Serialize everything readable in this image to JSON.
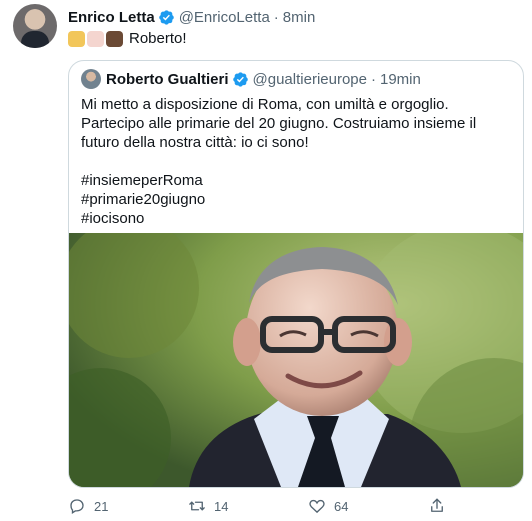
{
  "tweet": {
    "author_name": "Enrico Letta",
    "author_handle": "@EnricoLetta",
    "separator": "·",
    "time": "8min",
    "text": "Roberto!",
    "emojis": [
      {
        "name": "flexed-biceps-medium-light",
        "color": "#f2c65a"
      },
      {
        "name": "flexed-biceps-light",
        "color": "#f4d5cf"
      },
      {
        "name": "flexed-biceps-dark",
        "color": "#6b4a35"
      }
    ]
  },
  "quoted": {
    "author_name": "Roberto Gualtieri",
    "author_handle": "@gualtierieurope",
    "separator": "·",
    "time": "19min",
    "body": "Mi metto a disposizione di Roma, con umiltà e orgoglio. Partecipo alle primarie del 20 giugno. Costruiamo insieme il futuro della nostra città: io ci sono!",
    "hashtags": [
      "#insiemeperRoma",
      "#primarie20giugno",
      "#iocisono"
    ]
  },
  "actions": {
    "reply_count": "21",
    "retweet_count": "14",
    "like_count": "64"
  },
  "colors": {
    "verified": "#1d9bf0",
    "secondary_text": "#536471",
    "border": "#cfd9de"
  }
}
